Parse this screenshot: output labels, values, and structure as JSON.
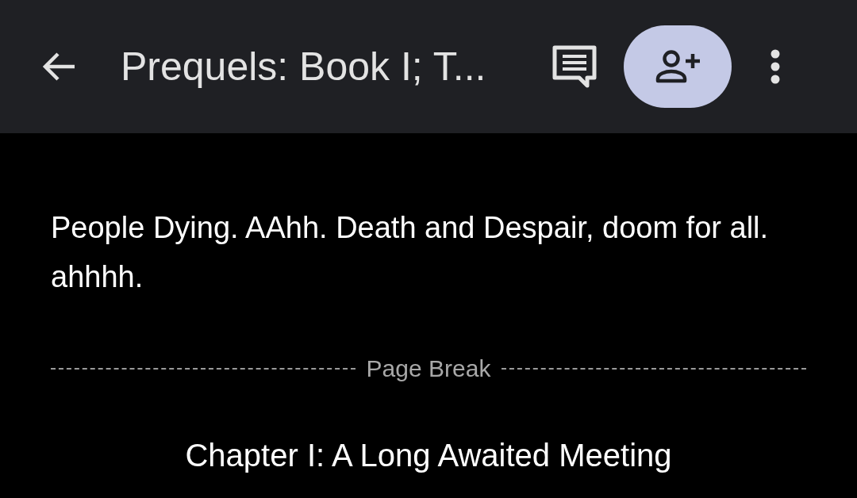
{
  "toolbar": {
    "title": "Prequels: Book I; T..."
  },
  "paragraph": "People Dying. AAhh. Death and Despair, doom for all. ahhhh.",
  "page_break": {
    "label": "Page Break"
  },
  "heading": "Chapter I: A Long Awaited Meeting"
}
